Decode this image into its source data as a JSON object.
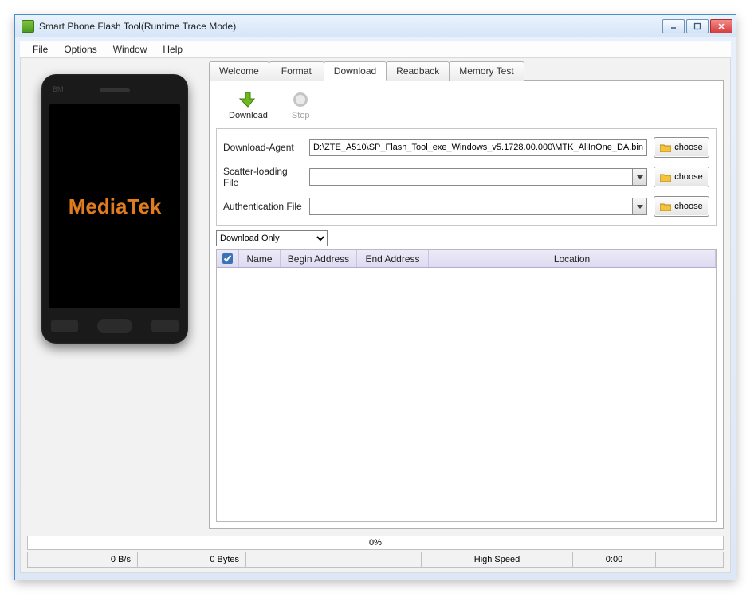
{
  "window": {
    "title": "Smart Phone Flash Tool(Runtime Trace Mode)"
  },
  "menu": {
    "file": "File",
    "options": "Options",
    "window": "Window",
    "help": "Help"
  },
  "phone": {
    "bm": "BM",
    "brand": "MediaTek"
  },
  "tabs": {
    "welcome": "Welcome",
    "format": "Format",
    "download": "Download",
    "readback": "Readback",
    "memtest": "Memory Test"
  },
  "toolbar": {
    "download": "Download",
    "stop": "Stop"
  },
  "form": {
    "da_label": "Download-Agent",
    "da_value": "D:\\ZTE_A510\\SP_Flash_Tool_exe_Windows_v5.1728.00.000\\MTK_AllInOne_DA.bin",
    "scatter_label": "Scatter-loading File",
    "scatter_value": "",
    "auth_label": "Authentication File",
    "auth_value": "",
    "choose": "choose"
  },
  "mode": {
    "selected": "Download Only"
  },
  "table": {
    "chk": "",
    "name": "Name",
    "begin": "Begin Address",
    "end": "End Address",
    "location": "Location"
  },
  "status": {
    "percent": "0%",
    "speed": "0 B/s",
    "bytes": "0 Bytes",
    "region": "",
    "conn": "High Speed",
    "time": "0:00"
  }
}
